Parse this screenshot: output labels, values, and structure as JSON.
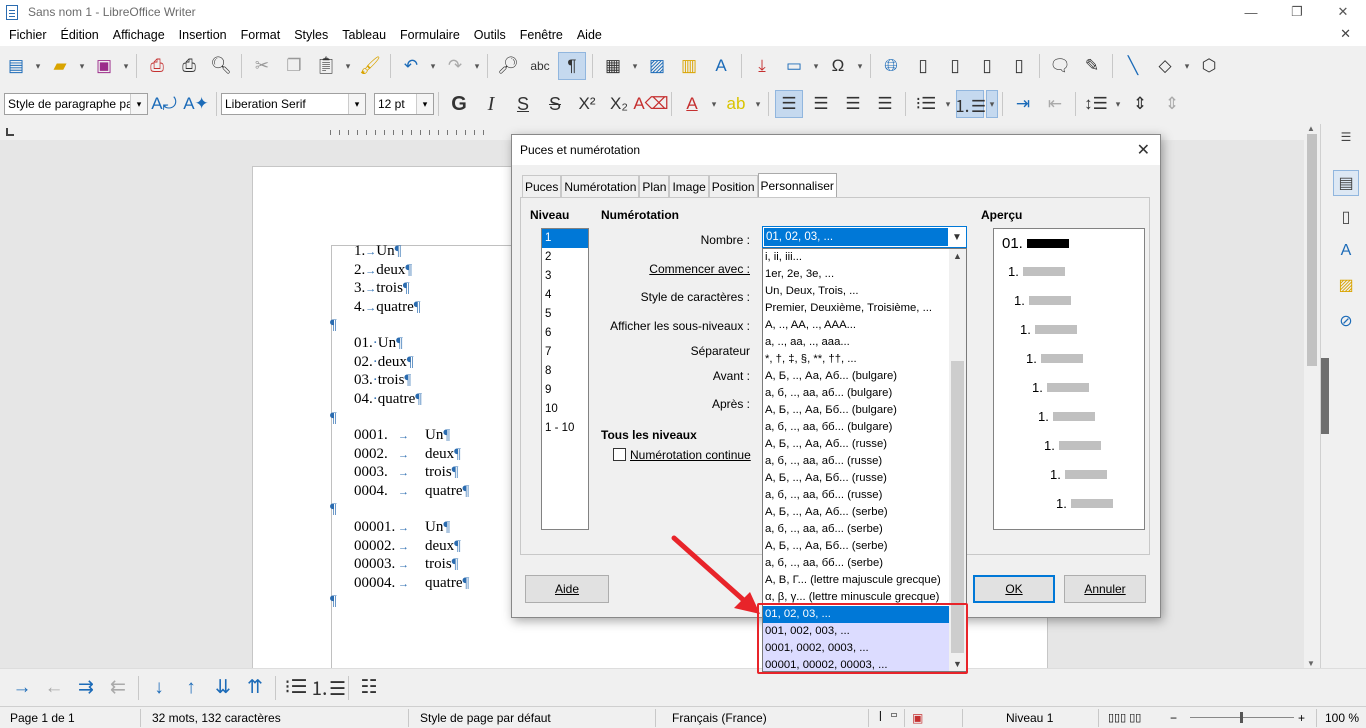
{
  "window": {
    "title": "Sans nom 1 - LibreOffice Writer"
  },
  "menu": [
    "Fichier",
    "Édition",
    "Affichage",
    "Insertion",
    "Format",
    "Styles",
    "Tableau",
    "Formulaire",
    "Outils",
    "Fenêtre",
    "Aide"
  ],
  "formatting": {
    "paragraph_style": "Style de paragraphe par",
    "font_name": "Liberation Serif",
    "font_size": "12 pt"
  },
  "document": {
    "list1": [
      {
        "num": "1.",
        "text": "Un"
      },
      {
        "num": "2.",
        "text": "deux"
      },
      {
        "num": "3.",
        "text": "trois"
      },
      {
        "num": "4.",
        "text": "quatre"
      }
    ],
    "list2": [
      {
        "num": "01.",
        "text": "Un"
      },
      {
        "num": "02.",
        "text": "deux"
      },
      {
        "num": "03.",
        "text": "trois"
      },
      {
        "num": "04.",
        "text": "quatre"
      }
    ],
    "list3": [
      {
        "num": "0001.",
        "text": "Un"
      },
      {
        "num": "0002.",
        "text": "deux"
      },
      {
        "num": "0003.",
        "text": "trois"
      },
      {
        "num": "0004.",
        "text": "quatre"
      }
    ],
    "list4": [
      {
        "num": "00001.",
        "text": "Un"
      },
      {
        "num": "00002.",
        "text": "deux"
      },
      {
        "num": "00003.",
        "text": "trois"
      },
      {
        "num": "00004.",
        "text": "quatre"
      }
    ],
    "pilcrow": "¶",
    "tab_arrow": "→",
    "space_dot": "·"
  },
  "dialog": {
    "title": "Puces et numérotation",
    "tabs": [
      "Puces",
      "Numérotation",
      "Plan",
      "Image",
      "Position",
      "Personnaliser"
    ],
    "active_tab": "Personnaliser",
    "niveau_label": "Niveau",
    "levels": [
      "1",
      "2",
      "3",
      "4",
      "5",
      "6",
      "7",
      "8",
      "9",
      "10",
      "1 - 10"
    ],
    "selected_level": "1",
    "numerotation_label": "Numérotation",
    "nombre_label": "Nombre :",
    "nombre_value": "01, 02, 03, ...",
    "commencer_label": "Commencer avec :",
    "style_car_label": "Style de caractères :",
    "sous_niveaux_label": "Afficher les sous-niveaux :",
    "separateur_label": "Séparateur",
    "avant_label": "Avant :",
    "apres_label": "Après :",
    "tous_niveaux_label": "Tous les niveaux",
    "num_continue_label": "Numérotation continue",
    "apercu_label": "Aperçu",
    "preview_first": "01.",
    "preview_rest": "1.",
    "btn_help": "Aide",
    "btn_ok": "OK",
    "btn_cancel": "Annuler",
    "dropdown_items": [
      "i, ii, iii...",
      "1er, 2e, 3e, ...",
      "Un, Deux, Trois, ...",
      "Premier, Deuxième, Troisième, ...",
      "A, .., AA, .., AAA...",
      "a, .., aa, .., aaa...",
      "*, †, ‡, §, **, ††, ...",
      "А, Б, .., Аа, Аб... (bulgare)",
      "а, б, .., аа, аб... (bulgare)",
      "А, Б, .., Аа, Бб... (bulgare)",
      "а, б, .., аа, бб... (bulgare)",
      "А, Б, .., Аа, Аб... (russe)",
      "а, б, .., аа, аб... (russe)",
      "А, Б, .., Аа, Бб... (russe)",
      "а, б, .., аа, бб... (russe)",
      "А, Б, .., Аа, Аб... (serbe)",
      "а, б, .., аа, аб... (serbe)",
      "А, Б, .., Аа, Бб... (serbe)",
      "а, б, .., аа, бб... (serbe)",
      "Α, Β, Γ... (lettre majuscule grecque)",
      "α, β, γ... (lettre minuscule grecque)",
      "01, 02, 03, ...",
      "001, 002, 003, ...",
      "0001, 0002, 0003, ...",
      "00001, 00002, 00003, ..."
    ],
    "dropdown_selected": "01, 02, 03, ..."
  },
  "status": {
    "page": "Page 1 de 1",
    "words": "32 mots, 132 caractères",
    "page_style": "Style de page par défaut",
    "language": "Français (France)",
    "level": "Niveau 1",
    "zoom": "100 %"
  },
  "colors": {
    "accent": "#0078d7",
    "annotation": "#e8242a",
    "highlight_rows": "#dcdcff"
  }
}
